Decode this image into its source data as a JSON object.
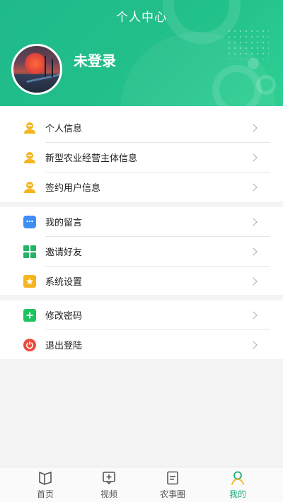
{
  "header": {
    "title": "个人中心",
    "username": "未登录",
    "colors": {
      "gradient_start": "#1fb98c",
      "gradient_end": "#2fcf93"
    }
  },
  "menu": {
    "group1": [
      {
        "label": "个人信息",
        "icon": "user-icon"
      },
      {
        "label": "新型农业经营主体信息",
        "icon": "user-icon"
      },
      {
        "label": "签约用户信息",
        "icon": "user-icon"
      }
    ],
    "group2": [
      {
        "label": "我的留言",
        "icon": "message-icon"
      },
      {
        "label": "邀请好友",
        "icon": "grid-icon"
      },
      {
        "label": "系统设置",
        "icon": "star-icon"
      }
    ],
    "group3": [
      {
        "label": "修改密码",
        "icon": "plus-icon"
      },
      {
        "label": "退出登陆",
        "icon": "power-icon"
      }
    ]
  },
  "nav": {
    "items": [
      {
        "label": "首页",
        "icon": "book-icon"
      },
      {
        "label": "视频",
        "icon": "video-icon"
      },
      {
        "label": "农事圈",
        "icon": "document-icon"
      },
      {
        "label": "我的",
        "icon": "person-icon",
        "active": true
      }
    ],
    "active_color": "#1fae78"
  }
}
